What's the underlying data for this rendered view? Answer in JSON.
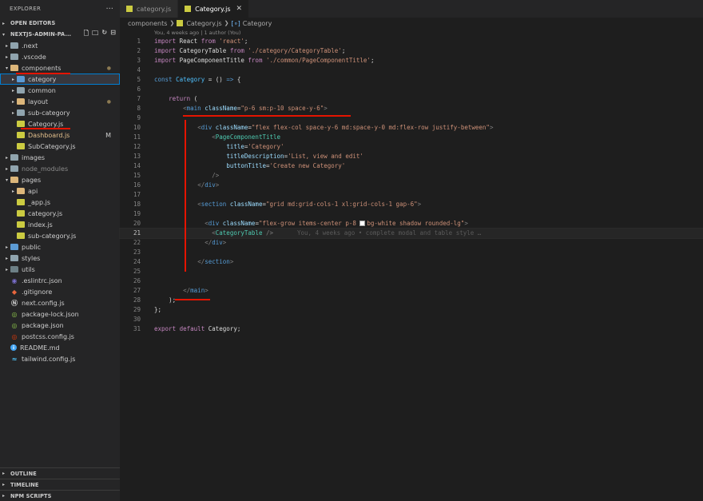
{
  "explorer": {
    "title": "EXPLORER",
    "more": "···",
    "open_editors": "OPEN EDITORS",
    "project": "NEXTJS-ADMIN-PA...",
    "tree": [
      {
        "label": ".next",
        "icon": "folder-icon",
        "depth": 0,
        "open": false,
        "style": ""
      },
      {
        "label": ".vscode",
        "icon": "folder-icon",
        "depth": 0,
        "open": false,
        "style": ""
      },
      {
        "label": "components",
        "icon": "folder-icon",
        "depth": 0,
        "open": true,
        "style": "dot"
      },
      {
        "label": "category",
        "icon": "folder-icon",
        "depth": 1,
        "open": false,
        "style": "sel"
      },
      {
        "label": "common",
        "icon": "folder-icon",
        "depth": 1,
        "open": false,
        "style": ""
      },
      {
        "label": "layout",
        "icon": "folder-icon",
        "depth": 1,
        "open": false,
        "style": "dot"
      },
      {
        "label": "sub-category",
        "icon": "folder-icon",
        "depth": 1,
        "open": false,
        "style": ""
      },
      {
        "label": "Category.js",
        "icon": "js-file-icon",
        "depth": 1,
        "file": true,
        "style": ""
      },
      {
        "label": "Dashboard.js",
        "icon": "js-file-icon",
        "depth": 1,
        "file": true,
        "style": "mod",
        "badge": "M"
      },
      {
        "label": "SubCategory.js",
        "icon": "js-file-icon",
        "depth": 1,
        "file": true,
        "style": ""
      },
      {
        "label": "images",
        "icon": "folder-icon",
        "depth": 0,
        "open": false,
        "style": ""
      },
      {
        "label": "node_modules",
        "icon": "folder-icon",
        "depth": 0,
        "open": false,
        "style": "dim"
      },
      {
        "label": "pages",
        "icon": "folder-icon",
        "depth": 0,
        "open": true,
        "style": ""
      },
      {
        "label": "api",
        "icon": "folder-icon",
        "depth": 1,
        "open": false,
        "style": ""
      },
      {
        "label": "_app.js",
        "icon": "js-file-icon",
        "depth": 1,
        "file": true,
        "style": ""
      },
      {
        "label": "category.js",
        "icon": "js-file-icon",
        "depth": 1,
        "file": true,
        "style": ""
      },
      {
        "label": "index.js",
        "icon": "js-file-icon",
        "depth": 1,
        "file": true,
        "style": ""
      },
      {
        "label": "sub-category.js",
        "icon": "js-file-icon",
        "depth": 1,
        "file": true,
        "style": ""
      },
      {
        "label": "public",
        "icon": "folder-icon",
        "depth": 0,
        "open": false,
        "style": ""
      },
      {
        "label": "styles",
        "icon": "folder-icon",
        "depth": 0,
        "open": false,
        "style": ""
      },
      {
        "label": "utils",
        "icon": "folder-icon",
        "depth": 0,
        "open": false,
        "style": ""
      },
      {
        "label": ".eslintrc.json",
        "icon": "eslint-icon",
        "depth": 0,
        "file": true,
        "style": ""
      },
      {
        "label": ".gitignore",
        "icon": "git-icon",
        "depth": 0,
        "file": true,
        "style": ""
      },
      {
        "label": "next.config.js",
        "icon": "next-icon",
        "depth": 0,
        "file": true,
        "style": ""
      },
      {
        "label": "package-lock.json",
        "icon": "npm-icon",
        "depth": 0,
        "file": true,
        "style": ""
      },
      {
        "label": "package.json",
        "icon": "npm-icon",
        "depth": 0,
        "file": true,
        "style": ""
      },
      {
        "label": "postcss.config.js",
        "icon": "postcss-icon",
        "depth": 0,
        "file": true,
        "style": ""
      },
      {
        "label": "README.md",
        "icon": "info-icon",
        "depth": 0,
        "file": true,
        "style": ""
      },
      {
        "label": "tailwind.config.js",
        "icon": "tailwind-icon",
        "depth": 0,
        "file": true,
        "style": ""
      }
    ],
    "bottom": [
      "OUTLINE",
      "TIMELINE",
      "NPM SCRIPTS"
    ]
  },
  "tabs": [
    {
      "label": "category.js",
      "active": false
    },
    {
      "label": "Category.js",
      "active": true,
      "close": "✕"
    }
  ],
  "breadcrumb": {
    "folder": "components",
    "file": "Category.js",
    "symbol": "Category"
  },
  "blame_header": "You, 4 weeks ago | 1 author (You)",
  "ghost_blame": "You, 4 weeks ago • complete modal and table style …",
  "current_line": 21,
  "code_lines": [
    "1",
    "2",
    "3",
    "4",
    "5",
    "6",
    "7",
    "8",
    "9",
    "10",
    "11",
    "12",
    "13",
    "14",
    "15",
    "16",
    "17",
    "18",
    "19",
    "20",
    "21",
    "22",
    "23",
    "24",
    "25",
    "26",
    "27",
    "28",
    "29",
    "30",
    "31"
  ],
  "colors": {
    "annotation": "#e51400",
    "selection_outline": "#007fd4"
  }
}
